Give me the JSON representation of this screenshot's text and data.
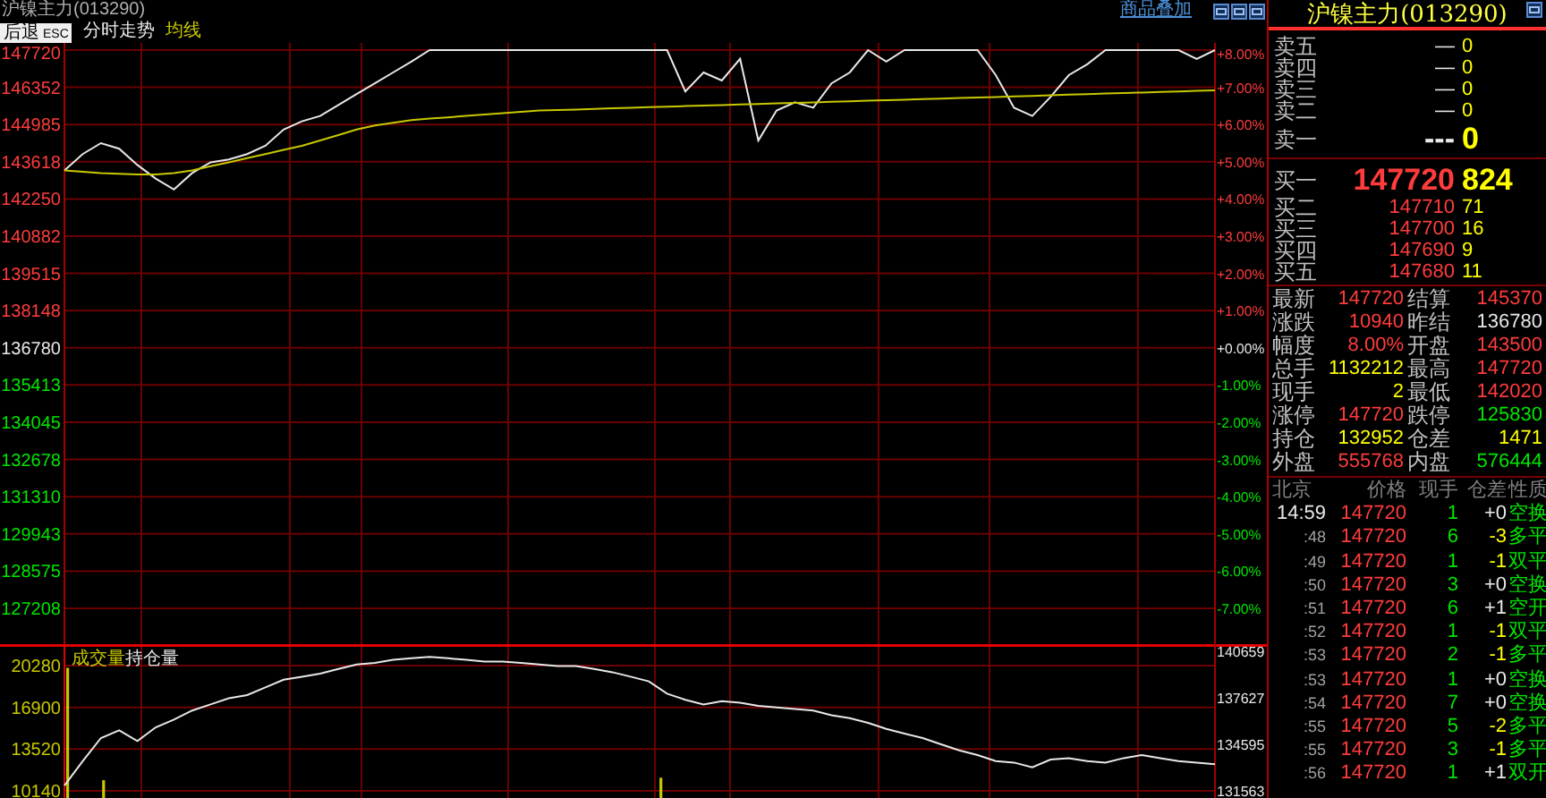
{
  "header": {
    "title": "沪镍主力(013290)",
    "overlay_link": "商品叠加"
  },
  "toolbar": {
    "back_button": {
      "label": "后退",
      "shortcut": "ESC"
    },
    "items": [
      {
        "label": "分时走势",
        "kind": "view"
      }
    ]
  },
  "price_panel": {
    "percent_labels": [
      {
        "label": "+8.00%",
        "color": "#ff3c3c"
      },
      {
        "label": "+7.00%",
        "color": "#ff3c3c"
      },
      {
        "label": "+6.00%",
        "color": "#ff3c3c"
      },
      {
        "label": "+5.00%",
        "color": "#ff3c3c"
      },
      {
        "label": "+4.00%",
        "color": "#ff3c3c"
      },
      {
        "label": "+3.00%",
        "color": "#ff3c3c"
      },
      {
        "label": "+2.00%",
        "color": "#ff3c3c"
      },
      {
        "label": "+1.00%",
        "color": "#ff3c3c"
      },
      {
        "label": "+0.00%",
        "color": "#e8e8e8"
      },
      {
        "label": "-1.00%",
        "color": "#00e600"
      },
      {
        "label": "-2.00%",
        "color": "#00e600"
      },
      {
        "label": "-3.00%",
        "color": "#00e600"
      },
      {
        "label": "-4.00%",
        "color": "#00e600"
      },
      {
        "label": "-5.00%",
        "color": "#00e600"
      },
      {
        "label": "-6.00%",
        "color": "#00e600"
      },
      {
        "label": "-7.00%",
        "color": "#00e600"
      }
    ],
    "chart_data": {
      "type": "line",
      "grid": true,
      "ylim": [
        125892,
        147983
      ],
      "yticks": [
        147720,
        146352,
        144985,
        143618,
        142250,
        140882,
        139515,
        138148,
        136780,
        135413,
        134045,
        132678,
        131310,
        129943,
        128575,
        127208
      ],
      "series": [
        {
          "color": "#e8e8e8",
          "values": [
            143300,
            143900,
            144300,
            144100,
            143500,
            143000,
            142600,
            143200,
            143600,
            143700,
            143900,
            144200,
            144800,
            145100,
            145300,
            145700,
            146100,
            146500,
            146900,
            147300,
            147720,
            147720,
            147720,
            147720,
            147720,
            147720,
            147720,
            147720,
            147720,
            147720,
            147720,
            147720,
            147720,
            147720,
            146200,
            146900,
            146600,
            147400,
            144400,
            145500,
            145800,
            145600,
            146500,
            146900,
            147720,
            147300,
            147720,
            147720,
            147720,
            147720,
            147720,
            146800,
            145600,
            145300,
            146000,
            146800,
            147200,
            147720,
            147720,
            147720,
            147720,
            147720,
            147400,
            147720
          ]
        },
        {
          "name": "均线",
          "color": "#c8c800",
          "values": [
            143300,
            143250,
            143200,
            143180,
            143150,
            143150,
            143200,
            143300,
            143450,
            143600,
            143750,
            143900,
            144050,
            144200,
            144400,
            144600,
            144800,
            144950,
            145050,
            145150,
            145200,
            145250,
            145300,
            145350,
            145400,
            145450,
            145500,
            145520,
            145540,
            145560,
            145580,
            145600,
            145620,
            145640,
            145660,
            145680,
            145700,
            145720,
            145740,
            145760,
            145780,
            145800,
            145820,
            145840,
            145860,
            145880,
            145900,
            145920,
            145940,
            145960,
            145980,
            146000,
            146020,
            146040,
            146060,
            146080,
            146100,
            146120,
            146140,
            146160,
            146180,
            146200,
            146220,
            146240
          ]
        }
      ]
    }
  },
  "volume_panel": {
    "chart_data": {
      "type": "bar",
      "grid": true,
      "ylim": [
        10140,
        20280
      ],
      "yticks": [
        20280,
        16900,
        13520,
        10140
      ],
      "series": [
        {
          "name": "成交量",
          "color": "#c8c800",
          "values": [
            20100,
            null,
            11000,
            null,
            null,
            null,
            null,
            null,
            null,
            null,
            null,
            null,
            null,
            null,
            null,
            null,
            null,
            null,
            null,
            null,
            null,
            null,
            null,
            null,
            null,
            null,
            null,
            null,
            null,
            null,
            null,
            null,
            null,
            11200,
            null,
            null,
            null,
            null,
            null,
            null,
            null,
            null,
            null,
            null,
            null,
            null,
            null,
            null,
            null,
            null,
            null,
            null,
            null,
            null,
            null,
            null,
            null,
            null,
            null,
            null,
            null,
            null,
            null,
            null
          ]
        }
      ]
    }
  },
  "open_interest": {
    "chart_data": {
      "type": "line",
      "ylim": [
        131563,
        140659
      ],
      "yticks": [
        140659,
        137627,
        134595,
        131563
      ],
      "series": [
        {
          "name": "持仓量",
          "color": "#e8e8e8",
          "values": [
            131900,
            133500,
            135000,
            135500,
            134800,
            135700,
            136200,
            136800,
            137200,
            137600,
            137800,
            138300,
            138800,
            139000,
            139200,
            139500,
            139800,
            139900,
            140100,
            140200,
            140300,
            140200,
            140100,
            140000,
            140000,
            139900,
            139800,
            139700,
            139700,
            139500,
            139300,
            139000,
            138700,
            137900,
            137500,
            137200,
            137400,
            137300,
            137100,
            137000,
            136900,
            136800,
            136500,
            136300,
            136000,
            135600,
            135300,
            135000,
            134600,
            134200,
            133900,
            133500,
            133400,
            133100,
            133600,
            133700,
            133500,
            133400,
            133700,
            133900,
            133700,
            133500,
            133400,
            133300
          ]
        }
      ]
    }
  },
  "quote": {
    "title": "沪镍主力(013290)",
    "asks": [
      {
        "label": "卖五",
        "price": "—",
        "volume": "0"
      },
      {
        "label": "卖四",
        "price": "—",
        "volume": "0"
      },
      {
        "label": "卖三",
        "price": "—",
        "volume": "0"
      },
      {
        "label": "卖二",
        "price": "—",
        "volume": "0"
      }
    ],
    "best_ask": {
      "label": "卖一",
      "price": "---",
      "volume": "0"
    },
    "best_bid": {
      "label": "买一",
      "price": "147720",
      "volume": "824"
    },
    "bids": [
      {
        "label": "买二",
        "price": "147710",
        "volume": "71"
      },
      {
        "label": "买三",
        "price": "147700",
        "volume": "16"
      },
      {
        "label": "买四",
        "price": "147690",
        "volume": "9"
      },
      {
        "label": "买五",
        "price": "147680",
        "volume": "11"
      }
    ],
    "stats": [
      {
        "label": "最新",
        "value": "147720",
        "color": "#ff3c3c"
      },
      {
        "label": "结算",
        "value": "145370",
        "color": "#ff3c3c"
      },
      {
        "label": "涨跌",
        "value": "10940",
        "color": "#ff3c3c"
      },
      {
        "label": "昨结",
        "value": "136780",
        "color": "#e8e8e8"
      },
      {
        "label": "幅度",
        "value": "8.00%",
        "color": "#ff3c3c"
      },
      {
        "label": "开盘",
        "value": "143500",
        "color": "#ff3c3c"
      },
      {
        "label": "总手",
        "value": "1132212",
        "color": "#ffff00"
      },
      {
        "label": "最高",
        "value": "147720",
        "color": "#ff3c3c"
      },
      {
        "label": "现手",
        "value": "2",
        "color": "#ffff00"
      },
      {
        "label": "最低",
        "value": "142020",
        "color": "#ff3c3c"
      },
      {
        "label": "涨停",
        "value": "147720",
        "color": "#ff3c3c"
      },
      {
        "label": "跌停",
        "value": "125830",
        "color": "#00e600"
      },
      {
        "label": "持仓",
        "value": "132952",
        "color": "#ffff00"
      },
      {
        "label": "仓差",
        "value": "1471",
        "color": "#ffff00"
      },
      {
        "label": "外盘",
        "value": "555768",
        "color": "#ff3c3c"
      },
      {
        "label": "内盘",
        "value": "576444",
        "color": "#00e600"
      }
    ],
    "trade_columns": [
      "北京",
      "价格",
      "现手",
      "仓差",
      "性质"
    ],
    "trades": [
      {
        "time": "14:59",
        "price": "147720",
        "volume": "1",
        "oi_change": "+0",
        "color": "#e8e8e8",
        "nature": "空换"
      },
      {
        "time": ":48",
        "price": "147720",
        "volume": "6",
        "oi_change": "-3",
        "color": "#ffff00",
        "nature": "多平"
      },
      {
        "time": ":49",
        "price": "147720",
        "volume": "1",
        "oi_change": "-1",
        "color": "#ffff00",
        "nature": "双平"
      },
      {
        "time": ":50",
        "price": "147720",
        "volume": "3",
        "oi_change": "+0",
        "color": "#e8e8e8",
        "nature": "空换"
      },
      {
        "time": ":51",
        "price": "147720",
        "volume": "6",
        "oi_change": "+1",
        "color": "#e8e8e8",
        "nature": "空开"
      },
      {
        "time": ":52",
        "price": "147720",
        "volume": "1",
        "oi_change": "-1",
        "color": "#ffff00",
        "nature": "双平"
      },
      {
        "time": ":53",
        "price": "147720",
        "volume": "2",
        "oi_change": "-1",
        "color": "#ffff00",
        "nature": "多平"
      },
      {
        "time": ":53",
        "price": "147720",
        "volume": "1",
        "oi_change": "+0",
        "color": "#e8e8e8",
        "nature": "空换"
      },
      {
        "time": ":54",
        "price": "147720",
        "volume": "7",
        "oi_change": "+0",
        "color": "#e8e8e8",
        "nature": "空换"
      },
      {
        "time": ":55",
        "price": "147720",
        "volume": "5",
        "oi_change": "-2",
        "color": "#ffff00",
        "nature": "多平"
      },
      {
        "time": ":55",
        "price": "147720",
        "volume": "3",
        "oi_change": "-1",
        "color": "#ffff00",
        "nature": "多平"
      },
      {
        "time": ":56",
        "price": "147720",
        "volume": "1",
        "oi_change": "+1",
        "color": "#e8e8e8",
        "nature": "双开"
      }
    ]
  }
}
